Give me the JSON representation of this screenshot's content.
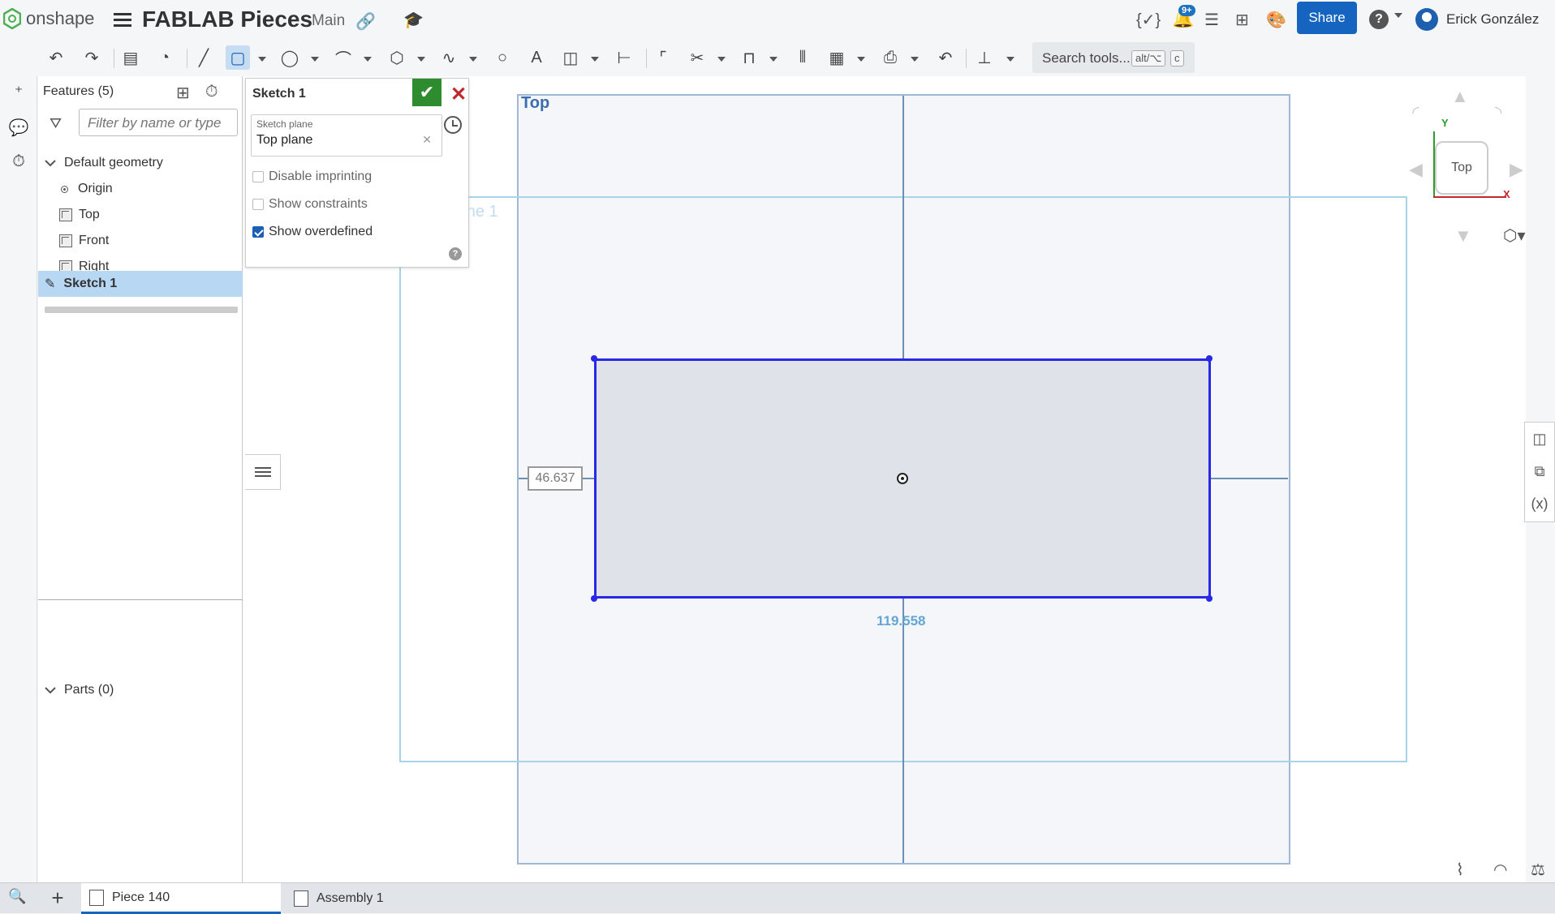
{
  "header": {
    "app_name": "onshape",
    "document_title": "FABLAB Pieces",
    "workspace": "Main",
    "notification_count": "9+",
    "share_label": "Share",
    "user_name": "Erick González"
  },
  "toolbar": {
    "search_label": "Search tools...",
    "shortcut_key1": "alt/⌥",
    "shortcut_key2": "c"
  },
  "feature_panel": {
    "title": "Features (5)",
    "filter_placeholder": "Filter by name or type",
    "default_geometry_label": "Default geometry",
    "items": [
      {
        "label": "Origin"
      },
      {
        "label": "Top"
      },
      {
        "label": "Front"
      },
      {
        "label": "Right"
      }
    ],
    "sketch_label": "Sketch 1",
    "parts_label": "Parts (0)"
  },
  "sketch_dialog": {
    "title": "Sketch 1",
    "plane_label": "Sketch plane",
    "plane_value": "Top plane",
    "options": [
      {
        "label": "Disable imprinting",
        "checked": false
      },
      {
        "label": "Show constraints",
        "checked": false
      },
      {
        "label": "Show overdefined",
        "checked": true
      }
    ]
  },
  "canvas": {
    "plane_label": "Top",
    "faint_label": "Top Plane 1",
    "dim_vertical": "46.637",
    "dim_horizontal": "119.558"
  },
  "view_cube": {
    "face_label": "Top",
    "axis_y": "Y",
    "axis_x": "X"
  },
  "tabs": [
    {
      "label": "Piece 140",
      "active": true
    },
    {
      "label": "Assembly 1",
      "active": false
    }
  ],
  "colors": {
    "accent": "#1565c0",
    "sketch_line": "#2828e6",
    "confirm": "#2e8b2e",
    "cancel": "#c0282b"
  }
}
